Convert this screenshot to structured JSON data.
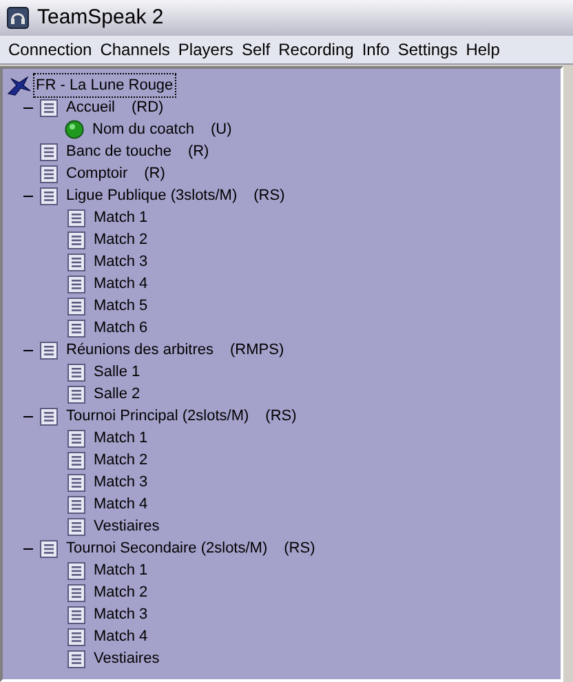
{
  "window": {
    "title": "TeamSpeak 2"
  },
  "menu": [
    "Connection",
    "Channels",
    "Players",
    "Self",
    "Recording",
    "Info",
    "Settings",
    "Help"
  ],
  "tree": {
    "server": {
      "name": "FR - La Lune Rouge",
      "selected": true
    },
    "channels": [
      {
        "kind": "channel",
        "name": "Accueil",
        "flags": "(RD)",
        "expanded": true,
        "children": [
          {
            "kind": "player",
            "name": "Nom du coatch",
            "flags": "(U)"
          }
        ]
      },
      {
        "kind": "channel",
        "name": "Banc de touche",
        "flags": "(R)"
      },
      {
        "kind": "channel",
        "name": "Comptoir",
        "flags": "(R)"
      },
      {
        "kind": "channel",
        "name": "Ligue Publique (3slots/M)",
        "flags": "(RS)",
        "expanded": true,
        "children": [
          {
            "kind": "channel",
            "name": "Match 1"
          },
          {
            "kind": "channel",
            "name": "Match 2"
          },
          {
            "kind": "channel",
            "name": "Match 3"
          },
          {
            "kind": "channel",
            "name": "Match 4"
          },
          {
            "kind": "channel",
            "name": "Match 5"
          },
          {
            "kind": "channel",
            "name": "Match 6"
          }
        ]
      },
      {
        "kind": "channel",
        "name": "Réunions des arbitres",
        "flags": "(RMPS)",
        "expanded": true,
        "children": [
          {
            "kind": "channel",
            "name": "Salle 1"
          },
          {
            "kind": "channel",
            "name": "Salle 2"
          }
        ]
      },
      {
        "kind": "channel",
        "name": "Tournoi Principal (2slots/M)",
        "flags": "(RS)",
        "expanded": true,
        "children": [
          {
            "kind": "channel",
            "name": "Match 1"
          },
          {
            "kind": "channel",
            "name": "Match 2"
          },
          {
            "kind": "channel",
            "name": "Match 3"
          },
          {
            "kind": "channel",
            "name": "Match 4"
          },
          {
            "kind": "channel",
            "name": "Vestiaires"
          }
        ]
      },
      {
        "kind": "channel",
        "name": "Tournoi Secondaire (2slots/M)",
        "flags": "(RS)",
        "expanded": true,
        "children": [
          {
            "kind": "channel",
            "name": "Match 1"
          },
          {
            "kind": "channel",
            "name": "Match 2"
          },
          {
            "kind": "channel",
            "name": "Match 3"
          },
          {
            "kind": "channel",
            "name": "Match 4"
          },
          {
            "kind": "channel",
            "name": "Vestiaires"
          }
        ]
      }
    ]
  }
}
